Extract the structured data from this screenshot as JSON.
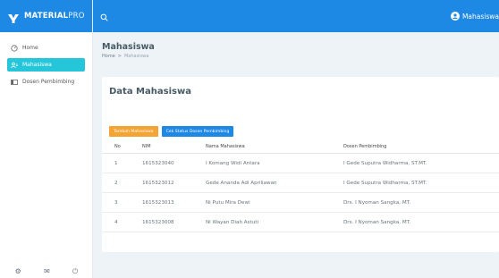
{
  "brand": {
    "name_bold": "MATERIAL",
    "name_thin": "PRO"
  },
  "colors": {
    "primary": "#1e88e5",
    "active": "#26c6da",
    "warning": "#f4a335"
  },
  "sidebar": {
    "items": [
      {
        "label": "Home",
        "icon": "gauge-icon",
        "active": false
      },
      {
        "label": "Mahasiswa",
        "icon": "users-icon",
        "active": true
      },
      {
        "label": "Dosen Pembimbing",
        "icon": "table-icon",
        "active": false
      }
    ],
    "footer_icons": [
      "settings-icon",
      "mail-icon",
      "power-icon"
    ]
  },
  "topbar": {
    "user_name": "Mahasiswa",
    "search_icon": "search-icon"
  },
  "page": {
    "title": "Mahasiswa",
    "breadcrumb": {
      "home": "Home",
      "separator": ">",
      "current": "Mahasiswa"
    }
  },
  "card": {
    "title": "Data Mahasiswa",
    "buttons": {
      "add": "Tambah Mahasiswa",
      "check": "Cek Status Dosen Pembimbing"
    },
    "table": {
      "headers": {
        "no": "No",
        "nim": "NIM",
        "name": "Nama Mahasiswa",
        "dosen": "Dosen Pembimbing"
      },
      "rows": [
        {
          "no": "1",
          "nim": "1615323040",
          "name": "I Komang Widi Antara",
          "dosen": "I Gede Suputra Widharma, ST.MT."
        },
        {
          "no": "2",
          "nim": "1615323012",
          "name": "Gede Ananda Adi Apriliawan",
          "dosen": "I Gede Suputra Widharma, ST.MT."
        },
        {
          "no": "3",
          "nim": "1615323013",
          "name": "Ni Putu Mira Dewi",
          "dosen": "Drs. I Nyoman Sangka, MT."
        },
        {
          "no": "4",
          "nim": "1615323008",
          "name": "Ni Wayan Diah Astuti",
          "dosen": "Drs. I Nyoman Sangka, MT."
        }
      ]
    }
  }
}
